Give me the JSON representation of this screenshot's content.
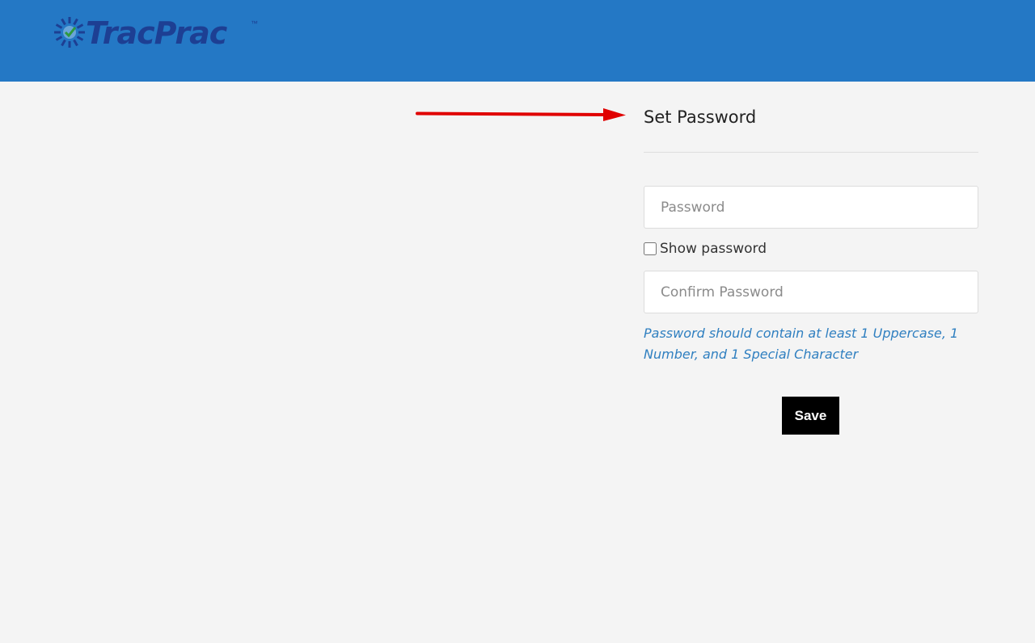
{
  "header": {
    "logo_text": "TracPrac",
    "logo_tm": "™",
    "background_color": "#2478c5",
    "logo_color": "#1d3f93"
  },
  "form": {
    "title": "Set Password",
    "password": {
      "placeholder": "Password",
      "value": ""
    },
    "show_password_label": "Show password",
    "show_password_checked": false,
    "confirm_password": {
      "placeholder": "Confirm Password",
      "value": ""
    },
    "hint": "Password should contain at least 1 Uppercase, 1 Number, and 1 Special Character",
    "save_label": "Save"
  },
  "annotation": {
    "icon": "red-arrow-icon",
    "color": "#e00000"
  }
}
